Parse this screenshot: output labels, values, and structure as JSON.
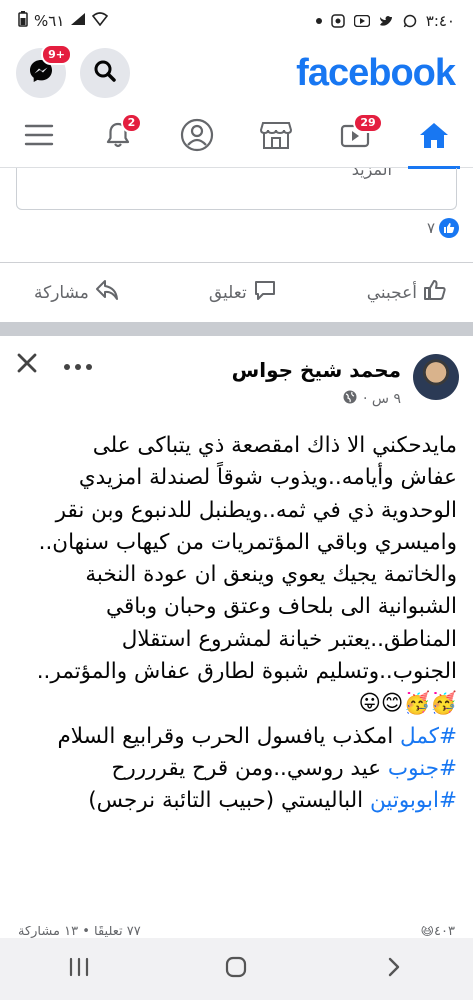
{
  "status_bar": {
    "time": "٣:٤٠",
    "battery": "%٦١"
  },
  "header": {
    "brand": "facebook",
    "messenger_badge": "9+"
  },
  "nav": {
    "video_badge": "29",
    "notifications_badge": "2"
  },
  "prev_post": {
    "comment_placeholder_cut": "المزيد",
    "reaction_count": "٧",
    "like_label": "أعجبني",
    "comment_label": "تعليق",
    "share_label": "مشاركة"
  },
  "post": {
    "author": "محمد شيخ جواس",
    "time": "٩ س ·",
    "lines": [
      "مايدحكني الا ذاك امقصعة ذي يتباكى على",
      "عفاش وأيامه..ويذوب شوقاً لصندلة امزيدي",
      "الوحدوية ذي في ثمه..ويطنبل للدنبوع وبن نقر",
      "واميسري وباقي المؤتمريات من كيهاب سنهان..",
      "والخاتمة يجيك يعوي وينعق ان عودة النخبة",
      "الشبوانية الى بلحاف وعتق وحبان وباقي",
      "المناطق..يعتبر خيانة لمشروع استقلال",
      "الجنوب..وتسليم شبوة لطارق عفاش والمؤتمر.."
    ],
    "emojis": "🥳🥳😊😛",
    "hashtag_lines": [
      {
        "tag": "#كمل",
        "text": " امكذب يافسول الحرب وقرابيع السلام"
      },
      {
        "tag": "#جنوب",
        "text": " عيد روسي..ومن قرح يقررررح"
      },
      {
        "tag": "#ابوبوتين",
        "text": " الباليستي (حبيب التائبة نرجس)"
      }
    ],
    "stats_cut_left": "٧٧ تعليقًا • ١٣ مشاركة",
    "stats_cut_right": "😆٤٠٣"
  }
}
